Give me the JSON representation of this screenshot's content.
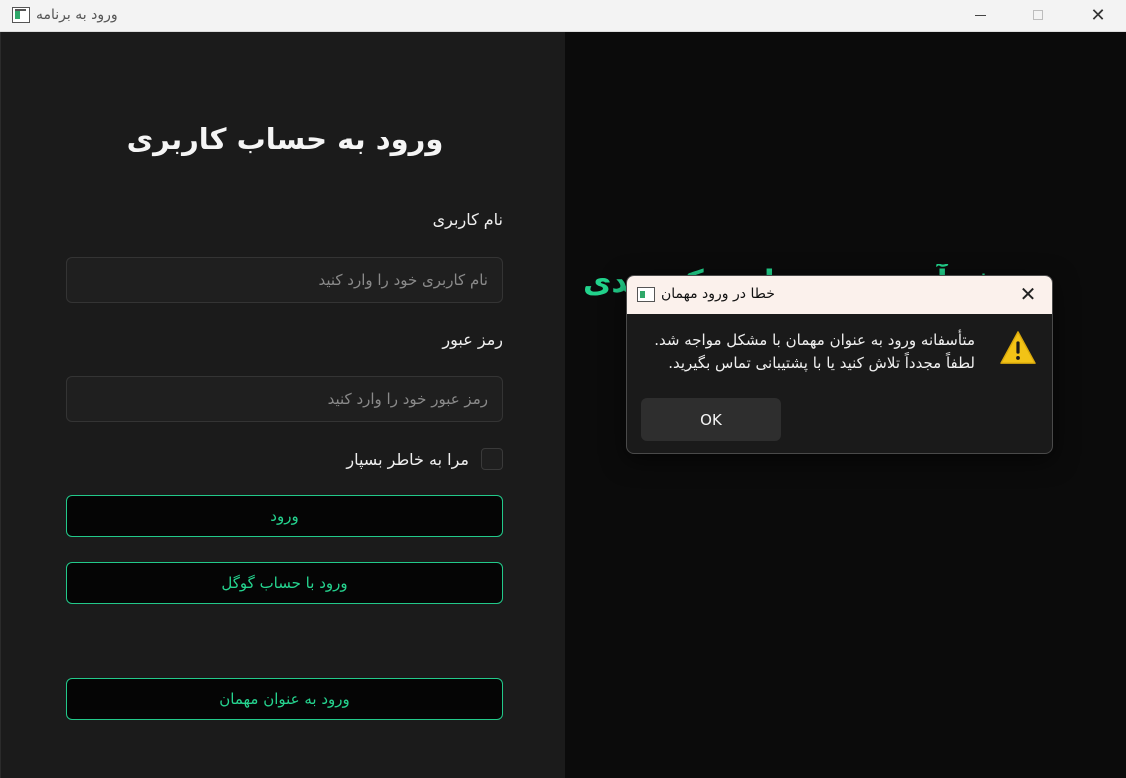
{
  "window": {
    "title": "ورود به برنامه",
    "minimize": "",
    "maximize": "",
    "close": "✕"
  },
  "login": {
    "title": "ورود به حساب کاربری",
    "username_label": "نام کاربری",
    "username_placeholder": "نام کاربری خود را وارد کنید",
    "password_label": "رمز عبور",
    "password_placeholder": "رمز عبور خود را وارد کنید",
    "remember_label": "مرا به خاطر بسپار",
    "login_button": "ورود",
    "google_button": "ورود با حساب گوگل",
    "guest_button": "ورود به عنوان مهمان"
  },
  "welcome": {
    "text": "خوش آمدید به برنامه تک‌برندی"
  },
  "dialog": {
    "title": "خطا در ورود مهمان",
    "close": "✕",
    "message_line1": "متأسفانه ورود به عنوان مهمان با مشکل مواجه شد.",
    "message_line2": "لطفاً مجدداً تلاش کنید یا با پشتیبانی تماس بگیرید.",
    "ok_button": "OK",
    "icon": "warning-icon"
  },
  "colors": {
    "accent": "#22d38c",
    "panel_left": "#1b1b1b",
    "panel_right": "#0b0b0b",
    "warning": "#f2c316"
  }
}
